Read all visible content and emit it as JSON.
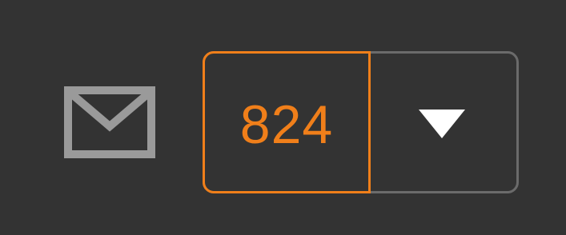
{
  "toolbar": {
    "icon": "mail-icon",
    "count": "824",
    "dropdown_icon": "chevron-down-icon"
  },
  "colors": {
    "background": "#333333",
    "accent": "#f07f1a",
    "border": "#6b6b6b",
    "icon": "#9a9a9a",
    "arrow": "#ffffff"
  }
}
